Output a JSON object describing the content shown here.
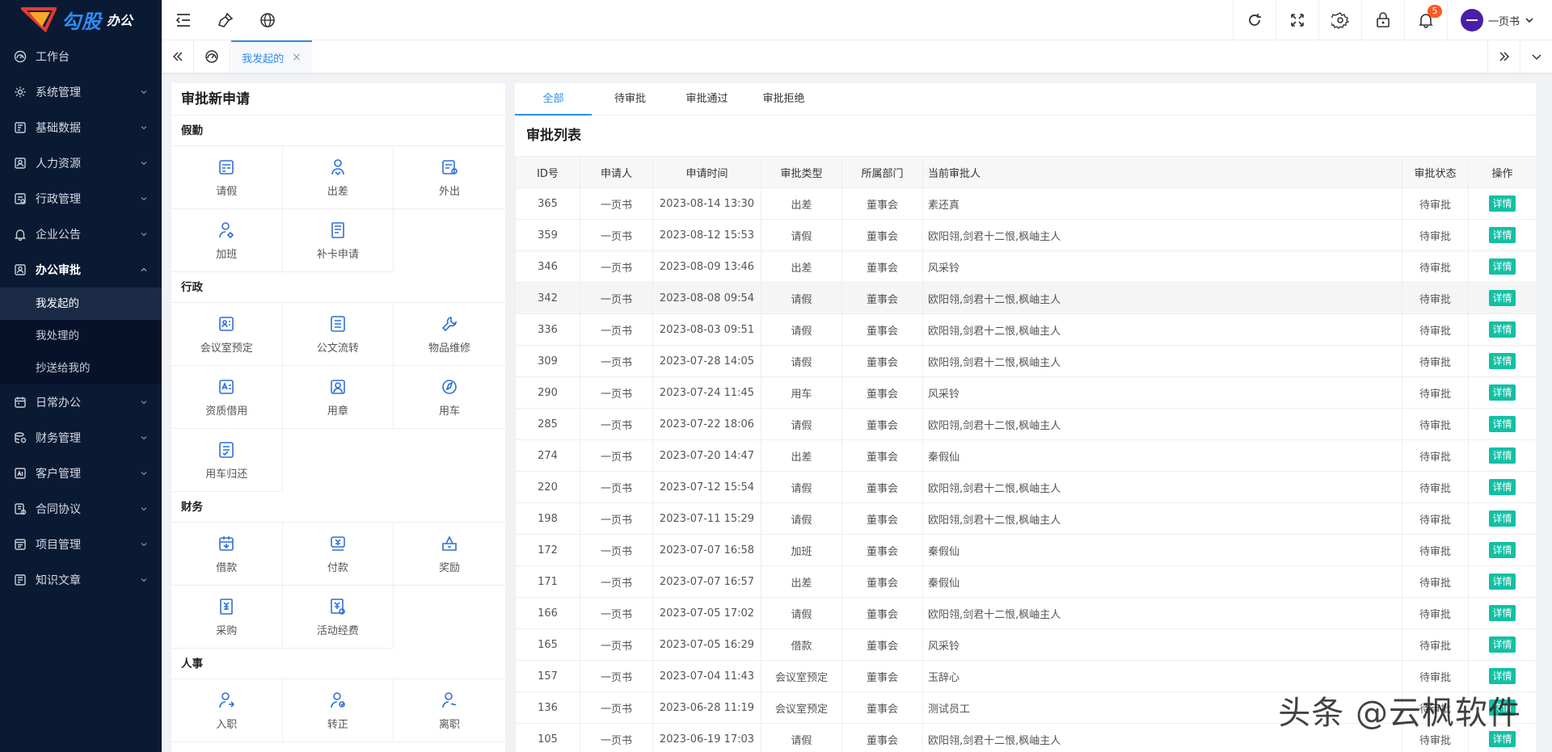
{
  "sidebar": {
    "logo": {
      "brand": "勾股",
      "sub": "办公",
      "mark": "OA"
    },
    "items": [
      {
        "label": "工作台",
        "icon": "dashboard-icon",
        "expandable": false
      },
      {
        "label": "系统管理",
        "icon": "settings-icon",
        "expandable": true
      },
      {
        "label": "基础数据",
        "icon": "database-icon",
        "expandable": true
      },
      {
        "label": "人力资源",
        "icon": "person-card-icon",
        "expandable": true
      },
      {
        "label": "行政管理",
        "icon": "admin-icon",
        "expandable": true
      },
      {
        "label": "企业公告",
        "icon": "bell-icon",
        "expandable": true
      },
      {
        "label": "办公审批",
        "icon": "approval-icon",
        "expandable": true,
        "open": true
      }
    ],
    "submenu": [
      {
        "label": "我发起的",
        "active": true
      },
      {
        "label": "我处理的"
      },
      {
        "label": "抄送给我的"
      }
    ],
    "items_after": [
      {
        "label": "日常办公",
        "icon": "calendar-icon"
      },
      {
        "label": "财务管理",
        "icon": "finance-icon"
      },
      {
        "label": "客户管理",
        "icon": "customer-icon"
      },
      {
        "label": "合同协议",
        "icon": "contract-icon"
      },
      {
        "label": "项目管理",
        "icon": "project-icon"
      },
      {
        "label": "知识文章",
        "icon": "article-icon"
      }
    ]
  },
  "header": {
    "notification_count": "5",
    "user_name": "一页书"
  },
  "tabs": {
    "active_tab": "我发起的"
  },
  "left_panel": {
    "title": "审批新申请",
    "categories": [
      {
        "title": "假勤",
        "items": [
          {
            "label": "请假",
            "icon": "leave-icon"
          },
          {
            "label": "出差",
            "icon": "business-trip-icon"
          },
          {
            "label": "外出",
            "icon": "outing-icon"
          },
          {
            "label": "加班",
            "icon": "overtime-icon"
          },
          {
            "label": "补卡申请",
            "icon": "card-replacement-icon"
          }
        ]
      },
      {
        "title": "行政",
        "items": [
          {
            "label": "会议室预定",
            "icon": "meeting-room-icon"
          },
          {
            "label": "公文流转",
            "icon": "document-flow-icon"
          },
          {
            "label": "物品维修",
            "icon": "repair-icon"
          },
          {
            "label": "资质借用",
            "icon": "qualification-icon"
          },
          {
            "label": "用章",
            "icon": "seal-icon"
          },
          {
            "label": "用车",
            "icon": "car-icon"
          },
          {
            "label": "用车归还",
            "icon": "car-return-icon"
          }
        ]
      },
      {
        "title": "财务",
        "items": [
          {
            "label": "借款",
            "icon": "loan-icon"
          },
          {
            "label": "付款",
            "icon": "payment-icon"
          },
          {
            "label": "奖励",
            "icon": "reward-icon"
          },
          {
            "label": "采购",
            "icon": "purchase-icon"
          },
          {
            "label": "活动经费",
            "icon": "activity-funds-icon"
          }
        ]
      },
      {
        "title": "人事",
        "items": [
          {
            "label": "入职",
            "icon": "onboarding-icon"
          },
          {
            "label": "转正",
            "icon": "regularization-icon"
          },
          {
            "label": "离职",
            "icon": "resignation-icon"
          }
        ]
      }
    ]
  },
  "right_panel": {
    "filter_tabs": [
      "全部",
      "待审批",
      "审批通过",
      "审批拒绝"
    ],
    "active_filter": 0,
    "title": "审批列表",
    "columns": [
      "ID号",
      "申请人",
      "申请时间",
      "审批类型",
      "所属部门",
      "当前审批人",
      "审批状态",
      "操作"
    ],
    "detail_label": "详情",
    "rows": [
      {
        "id": "365",
        "applicant": "一页书",
        "time": "2023-08-14 13:30",
        "type": "出差",
        "dept": "董事会",
        "approver": "素还真",
        "status": "待审批"
      },
      {
        "id": "359",
        "applicant": "一页书",
        "time": "2023-08-12 15:53",
        "type": "请假",
        "dept": "董事会",
        "approver": "欧阳翎,剑君十二恨,枫岫主人",
        "status": "待审批"
      },
      {
        "id": "346",
        "applicant": "一页书",
        "time": "2023-08-09 13:46",
        "type": "出差",
        "dept": "董事会",
        "approver": "风采铃",
        "status": "待审批"
      },
      {
        "id": "342",
        "applicant": "一页书",
        "time": "2023-08-08 09:54",
        "type": "请假",
        "dept": "董事会",
        "approver": "欧阳翎,剑君十二恨,枫岫主人",
        "status": "待审批"
      },
      {
        "id": "336",
        "applicant": "一页书",
        "time": "2023-08-03 09:51",
        "type": "请假",
        "dept": "董事会",
        "approver": "欧阳翎,剑君十二恨,枫岫主人",
        "status": "待审批"
      },
      {
        "id": "309",
        "applicant": "一页书",
        "time": "2023-07-28 14:05",
        "type": "请假",
        "dept": "董事会",
        "approver": "欧阳翎,剑君十二恨,枫岫主人",
        "status": "待审批"
      },
      {
        "id": "290",
        "applicant": "一页书",
        "time": "2023-07-24 11:45",
        "type": "用车",
        "dept": "董事会",
        "approver": "风采铃",
        "status": "待审批"
      },
      {
        "id": "285",
        "applicant": "一页书",
        "time": "2023-07-22 18:06",
        "type": "请假",
        "dept": "董事会",
        "approver": "欧阳翎,剑君十二恨,枫岫主人",
        "status": "待审批"
      },
      {
        "id": "274",
        "applicant": "一页书",
        "time": "2023-07-20 14:47",
        "type": "出差",
        "dept": "董事会",
        "approver": "秦假仙",
        "status": "待审批"
      },
      {
        "id": "220",
        "applicant": "一页书",
        "time": "2023-07-12 15:54",
        "type": "请假",
        "dept": "董事会",
        "approver": "欧阳翎,剑君十二恨,枫岫主人",
        "status": "待审批"
      },
      {
        "id": "198",
        "applicant": "一页书",
        "time": "2023-07-11 15:29",
        "type": "请假",
        "dept": "董事会",
        "approver": "欧阳翎,剑君十二恨,枫岫主人",
        "status": "待审批"
      },
      {
        "id": "172",
        "applicant": "一页书",
        "time": "2023-07-07 16:58",
        "type": "加班",
        "dept": "董事会",
        "approver": "秦假仙",
        "status": "待审批"
      },
      {
        "id": "171",
        "applicant": "一页书",
        "time": "2023-07-07 16:57",
        "type": "出差",
        "dept": "董事会",
        "approver": "秦假仙",
        "status": "待审批"
      },
      {
        "id": "166",
        "applicant": "一页书",
        "time": "2023-07-05 17:02",
        "type": "请假",
        "dept": "董事会",
        "approver": "欧阳翎,剑君十二恨,枫岫主人",
        "status": "待审批"
      },
      {
        "id": "165",
        "applicant": "一页书",
        "time": "2023-07-05 16:29",
        "type": "借款",
        "dept": "董事会",
        "approver": "风采铃",
        "status": "待审批"
      },
      {
        "id": "157",
        "applicant": "一页书",
        "time": "2023-07-04 11:43",
        "type": "会议室预定",
        "dept": "董事会",
        "approver": "玉辞心",
        "status": "待审批"
      },
      {
        "id": "136",
        "applicant": "一页书",
        "time": "2023-06-28 11:19",
        "type": "会议室预定",
        "dept": "董事会",
        "approver": "测试员工",
        "status": "待审批"
      },
      {
        "id": "105",
        "applicant": "一页书",
        "time": "2023-06-19 17:03",
        "type": "请假",
        "dept": "董事会",
        "approver": "欧阳翎,剑君十二恨,枫岫主人",
        "status": "待审批"
      }
    ]
  },
  "watermark": "头条 @云枫软件",
  "colors": {
    "sidebar_bg": "#0b1a33",
    "accent": "#2f8cf0",
    "detail_btn": "#12c0a4",
    "badge": "#ff5722"
  }
}
